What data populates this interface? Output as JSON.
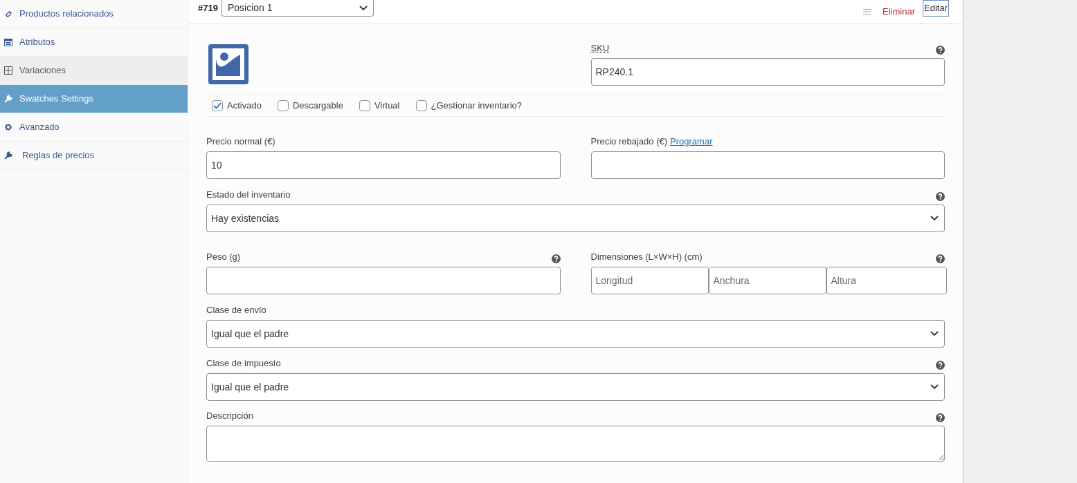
{
  "sidebar": {
    "items": [
      {
        "label": "Productos relacionados",
        "selected": false,
        "current": false
      },
      {
        "label": "Atributos",
        "selected": false,
        "current": false
      },
      {
        "label": "Variaciones",
        "selected": false,
        "current": true
      },
      {
        "label": "Swatches Settings",
        "selected": true,
        "current": false
      },
      {
        "label": "Avanzado",
        "selected": false,
        "current": false
      },
      {
        "label": "Reglas de precios",
        "selected": false,
        "current": false
      }
    ]
  },
  "variation": {
    "number": "#719",
    "attribute_select": "Posicion 1",
    "actions": [
      {
        "kind": "menu"
      },
      {
        "kind": "delete",
        "label": "Eliminar"
      },
      {
        "kind": "edit",
        "label": "Editar"
      }
    ]
  },
  "sku": {
    "label": "SKU",
    "value": "RP240.1",
    "help": true
  },
  "options": [
    {
      "label": "Activado",
      "checked": true
    },
    {
      "label": "Descargable",
      "checked": false
    },
    {
      "label": "Virtual",
      "checked": false
    },
    {
      "label": "¿Gestionar inventario?",
      "checked": false
    }
  ],
  "rows": [
    [
      {
        "kind": "text",
        "label": "Precio normal (€)",
        "value": "10",
        "help": false
      },
      {
        "kind": "text",
        "label": "Precio rebajado (€)",
        "link": "Programar",
        "help": false
      }
    ],
    [
      {
        "kind": "select",
        "label": "Estado del inventario",
        "value": "Hay existencias",
        "help": true
      }
    ],
    [
      {
        "kind": "text",
        "label": "Peso (g)",
        "help": true
      },
      {
        "kind": "dimensions",
        "label": "Dimensiones (L×W×H) (cm)",
        "placeholders": [
          "Longitud",
          "Anchura",
          "Altura"
        ],
        "help": true
      }
    ],
    [
      {
        "kind": "select",
        "label": "Clase de envío",
        "value": "Igual que el padre",
        "help": false
      }
    ],
    [
      {
        "kind": "select",
        "label": "Clase de impuesto",
        "value": "Igual que el padre",
        "help": true
      }
    ],
    [
      {
        "kind": "textarea",
        "label": "Descripción",
        "help": true
      }
    ]
  ]
}
